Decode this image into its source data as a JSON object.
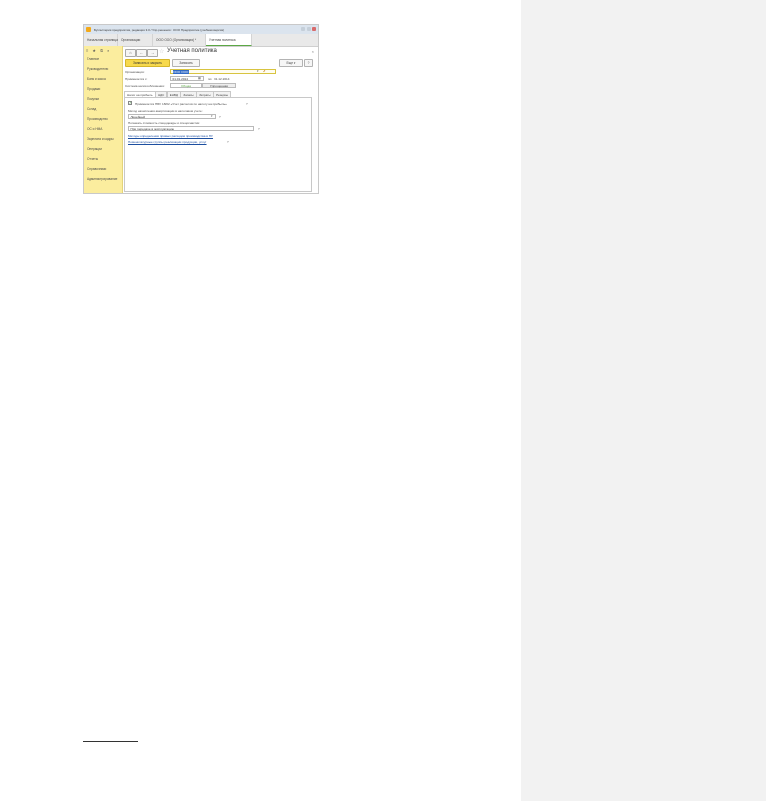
{
  "window": {
    "title": "Бухгалтерия предприятия, редакция 3.0 / Упр.решения : ООО Предприятие (учебная версия)"
  },
  "tabs": [
    {
      "label": "Начальная страница"
    },
    {
      "label": "Организации"
    },
    {
      "label": "ООО ООО (Организация) *"
    },
    {
      "label": "Учетная политика"
    }
  ],
  "sidebar": {
    "tools": [
      "≡",
      "★",
      "⏲",
      "⌕"
    ],
    "items": [
      {
        "label": "Главное"
      },
      {
        "label": "Руководителю"
      },
      {
        "label": "Банк и касса"
      },
      {
        "label": "Продажи"
      },
      {
        "label": "Покупки"
      },
      {
        "label": "Склад"
      },
      {
        "label": "Производство"
      },
      {
        "label": "ОС и НМА"
      },
      {
        "label": "Зарплата и кадры"
      },
      {
        "label": "Операции"
      },
      {
        "label": "Отчеты"
      },
      {
        "label": "Справочники"
      },
      {
        "label": "Администрирование"
      }
    ]
  },
  "form": {
    "title": "Учетная политика",
    "more_label": "Еще",
    "help_label": "?",
    "close_label": "×",
    "buttons": {
      "save_close": "Записать и закрыть",
      "save": "Записать"
    },
    "organization": {
      "label": "Организация:",
      "value": "ООО ООО"
    },
    "applies_from": {
      "label": "Применяется с:",
      "value": "01.01.2014",
      "to_label": "по:",
      "to_value": "31.12.2014"
    },
    "tax_system": {
      "label": "Система налогообложения:",
      "options": [
        "Общая",
        "Упрощенная"
      ],
      "selected": "Общая"
    },
    "subtabs": [
      "Налог на прибыль",
      "НДС",
      "ЕНВД",
      "Запасы",
      "Затраты",
      "Резервы"
    ],
    "profit_tab": {
      "pbu18_label": "Применяется ПБУ 18/02 «Учет расчетов по налогу на прибыль»",
      "pbu18_checked": true,
      "depreciation_label": "Метод начисления амортизации в налоговом учете:",
      "depreciation_value": "Линейный",
      "overalls_label": "Погашать стоимость спецодежды и спецоснастки:",
      "overalls_value": "При передаче в эксплуатацию",
      "link1": "Методы определения прямых расходов производства в НУ",
      "link2": "Номенклатурные группы реализации продукции, услуг"
    }
  }
}
